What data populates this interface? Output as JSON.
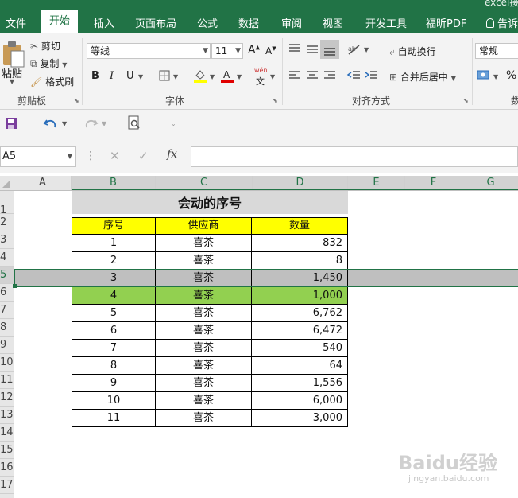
{
  "title_fragment": "excel接",
  "tabs": [
    "文件",
    "开始",
    "插入",
    "页面布局",
    "公式",
    "数据",
    "审阅",
    "视图",
    "开发工具",
    "福昕PDF"
  ],
  "tell_me": "告诉",
  "ribbon": {
    "clipboard": {
      "paste": "粘贴",
      "cut": "剪切",
      "copy": "复制",
      "format_painter": "格式刷",
      "label": "剪贴板"
    },
    "font": {
      "name": "等线",
      "size": "11",
      "bold": "B",
      "italic": "I",
      "underline": "U",
      "grow": "A",
      "shrink": "A",
      "phonetic_top": "wén",
      "phonetic_bottom": "文",
      "label": "字体"
    },
    "alignment": {
      "wrap": "自动换行",
      "merge": "合并后居中",
      "label": "对齐方式"
    },
    "number": {
      "format": "常规",
      "percent": "%",
      "label": "数"
    }
  },
  "formula_bar": {
    "name_box": "A5",
    "cancel": "✕",
    "confirm": "✓",
    "fx": "fx",
    "content": ""
  },
  "columns": [
    "A",
    "B",
    "C",
    "D",
    "E",
    "F",
    "G"
  ],
  "rows": [
    "1",
    "2",
    "3",
    "4",
    "5",
    "6",
    "7",
    "8",
    "9",
    "10",
    "11",
    "12",
    "13",
    "14",
    "15",
    "16",
    "17"
  ],
  "table": {
    "title": "会动的序号",
    "headers": [
      "序号",
      "供应商",
      "数量"
    ],
    "rows": [
      {
        "seq": "1",
        "supplier": "喜茶",
        "qty": "832"
      },
      {
        "seq": "2",
        "supplier": "喜茶",
        "qty": "8"
      },
      {
        "seq": "3",
        "supplier": "喜茶",
        "qty": "1,450"
      },
      {
        "seq": "4",
        "supplier": "喜茶",
        "qty": "1,000"
      },
      {
        "seq": "5",
        "supplier": "喜茶",
        "qty": "6,762"
      },
      {
        "seq": "6",
        "supplier": "喜茶",
        "qty": "6,472"
      },
      {
        "seq": "7",
        "supplier": "喜茶",
        "qty": "540"
      },
      {
        "seq": "8",
        "supplier": "喜茶",
        "qty": "64"
      },
      {
        "seq": "9",
        "supplier": "喜茶",
        "qty": "1,556"
      },
      {
        "seq": "10",
        "supplier": "喜茶",
        "qty": "6,000"
      },
      {
        "seq": "11",
        "supplier": "喜茶",
        "qty": "3,000"
      }
    ]
  },
  "colors": {
    "accent": "#217346",
    "header_fill": "#ffff00",
    "title_fill": "#d9d9d9",
    "selected_fill": "#bfbfbf",
    "highlight_fill": "#92d050"
  },
  "watermark": {
    "brand": "Baidu经验",
    "url": "jingyan.baidu.com"
  }
}
